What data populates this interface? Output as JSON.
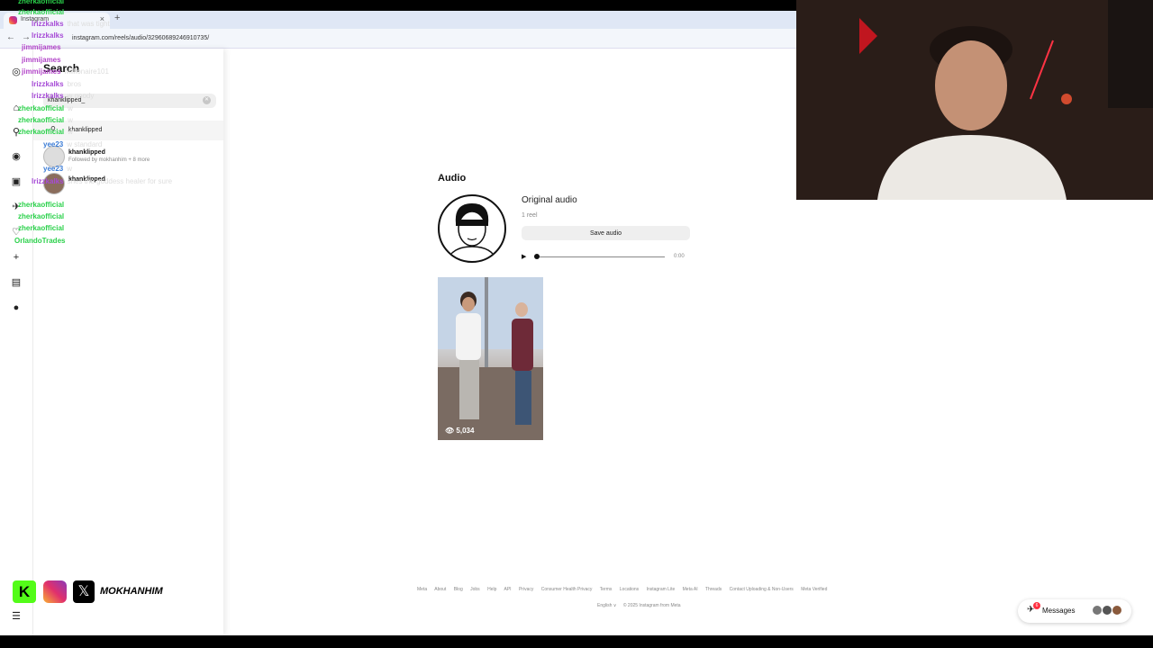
{
  "browser": {
    "tab_title": "Instagram",
    "close_glyph": "×",
    "new_tab_glyph": "+",
    "back_glyph": "←",
    "forward_glyph": "→",
    "url": "instagram.com/reels/audio/3296068924691073​5/"
  },
  "rail": {
    "icons": [
      "instagram-icon",
      "home-icon",
      "search-icon",
      "explore-icon",
      "reels-icon",
      "messages-icon",
      "notifications-icon",
      "create-icon",
      "dashboard-icon",
      "profile-icon",
      "more-icon"
    ]
  },
  "search": {
    "title": "Search",
    "query": "khanklipped_",
    "clear_glyph": "✕",
    "suggestion": "khanklipped",
    "results": [
      {
        "name": "khanklipped",
        "sub": "Followed by mokhanhim + 8 more"
      },
      {
        "name": "khanklipped",
        "sub": ""
      }
    ]
  },
  "audio": {
    "heading": "Audio",
    "title": "Original audio",
    "count": "1 reel",
    "save_label": "Save audio",
    "play_glyph": "▶",
    "time": "0:00",
    "progress": 0
  },
  "reel": {
    "views": "5,034",
    "eye_glyph": "👁"
  },
  "footer": {
    "links": [
      "Meta",
      "About",
      "Blog",
      "Jobs",
      "Help",
      "API",
      "Privacy",
      "Consumer Health Privacy",
      "Terms",
      "Locations",
      "Instagram Lite",
      "Meta AI",
      "Threads",
      "Contact Uploading & Non-Users",
      "Meta Verified"
    ],
    "language": "English ∨",
    "copyright": "© 2025 Instagram from Meta"
  },
  "messages": {
    "label": "Messages",
    "badge": "6"
  },
  "chat": [
    {
      "user": "zherkaofficial",
      "msg": "",
      "color": "#2bd14b"
    },
    {
      "user": "zherkaofficial",
      "msg": "",
      "color": "#2bd14b"
    },
    {
      "user": "lrizzkalks",
      "msg": "that was tight",
      "color": "#a64bd6"
    },
    {
      "user": "lrizzkalks",
      "msg": "",
      "color": "#a64bd6"
    },
    {
      "user": "jimmijames",
      "msg": "",
      "color": "#b347c9"
    },
    {
      "user": "jimmijames",
      "msg": "",
      "color": "#b347c9"
    },
    {
      "user": "jimmijames",
      "msg": "Millionaire101",
      "color": "#b347c9"
    },
    {
      "user": "lrizzkalks",
      "msg": "bros",
      "color": "#a64bd6"
    },
    {
      "user": "lrizzkalks",
      "msg": "w goody",
      "color": "#a64bd6"
    },
    {
      "user": "zherkaofficial",
      "msg": "w",
      "color": "#2bd14b"
    },
    {
      "user": "zherkaofficial",
      "msg": "w",
      "color": "#2bd14b"
    },
    {
      "user": "zherkaofficial",
      "msg": "w",
      "color": "#2bd14b"
    },
    {
      "user": "yee23",
      "msg": "w standard",
      "color": "#3a7bd5"
    },
    {
      "user": "yee23",
      "msg": "w",
      "color": "#3a7bd5"
    },
    {
      "user": "lrizzkalks",
      "msg": "shes the goddess healer for sure",
      "color": "#a64bd6"
    },
    {
      "user": "zherkaofficial",
      "msg": "",
      "color": "#2bd14b"
    },
    {
      "user": "zherkaofficial",
      "msg": "",
      "color": "#2bd14b"
    },
    {
      "user": "zherkaofficial",
      "msg": "",
      "color": "#2bd14b"
    },
    {
      "user": "OrlandoTrades",
      "msg": "",
      "color": "#2bd14b"
    }
  ],
  "social": {
    "kick_letter": "K",
    "x_letter": "𝕏",
    "handle": "MOKHANHIM"
  },
  "colors": {
    "instagram_gradient": [
      "#f9b233",
      "#e1306c",
      "#8a3ab9"
    ],
    "kick_green": "#53fc18",
    "notification_red": "#ff3040"
  }
}
